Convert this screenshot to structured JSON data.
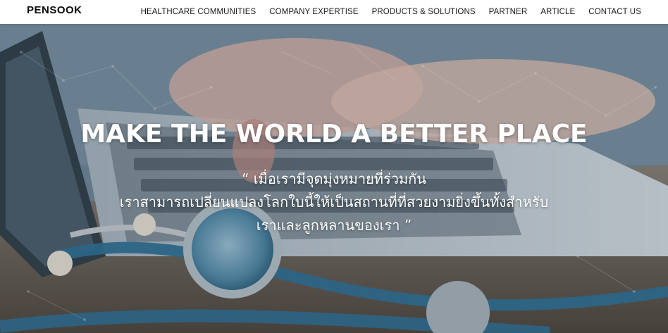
{
  "header": {
    "logo": "PENSOOK",
    "nav": [
      {
        "label": "HEALTHCARE COMMUNITIES"
      },
      {
        "label": "COMPANY EXPERTISE"
      },
      {
        "label": "PRODUCTS & SOLUTIONS"
      },
      {
        "label": "PARTNER"
      },
      {
        "label": "ARTICLE"
      },
      {
        "label": "CONTACT US"
      }
    ]
  },
  "hero": {
    "title": "MAKE THE WORLD A BETTER PLACE",
    "quote_lines": [
      "“ เมื่อเรามีจุดมุ่งหมายที่ร่วมกัน",
      "เราสามารถเปลี่ยนแปลงโลกใบนี้ให้เป็นสถานที่ที่สวยงามยิ่งขึ้นทั้งสำหรับ",
      "เราและลูกหลานของเรา ”"
    ]
  }
}
